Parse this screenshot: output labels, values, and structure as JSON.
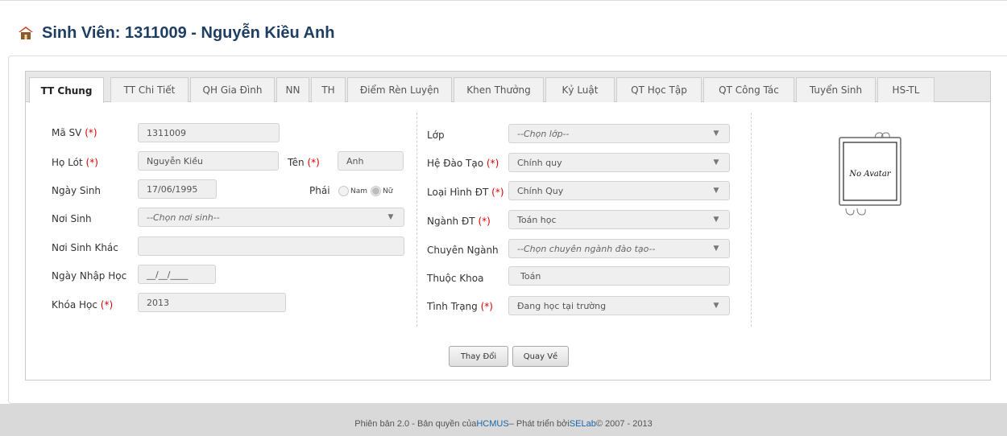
{
  "header": {
    "title": "Sinh Viên: 1311009 - Nguyễn Kiều Anh",
    "icon": "home-icon"
  },
  "tabs": [
    {
      "label": "TT Chung",
      "active": true
    },
    {
      "label": "TT Chi Tiết",
      "active": false
    },
    {
      "label": "QH Gia Đình",
      "active": false
    },
    {
      "label": "NN",
      "active": false
    },
    {
      "label": "TH",
      "active": false
    },
    {
      "label": "Điểm Rèn Luyện",
      "active": false
    },
    {
      "label": "Khen Thưởng",
      "active": false
    },
    {
      "label": "Kỷ Luật",
      "active": false
    },
    {
      "label": "QT Học Tập",
      "active": false
    },
    {
      "label": "QT Công Tác",
      "active": false
    },
    {
      "label": "Tuyển Sinh",
      "active": false
    },
    {
      "label": "HS-TL",
      "active": false
    }
  ],
  "required_mark": "(*)",
  "form_left": {
    "ma_sv": {
      "label": "Mã SV",
      "value": "1311009"
    },
    "ho_lot": {
      "label": "Họ Lót",
      "value": "Nguyễn Kiều"
    },
    "ten": {
      "label": "Tên",
      "value": "Anh"
    },
    "ngay_sinh": {
      "label": "Ngày Sinh",
      "value": "17/06/1995"
    },
    "phai": {
      "label": "Phái",
      "option_male": "Nam",
      "option_female": "Nữ",
      "selected": "Nữ"
    },
    "noi_sinh": {
      "label": "Nơi Sinh",
      "value": "--Chọn nơi sinh--"
    },
    "noi_sinh_khac": {
      "label": "Nơi Sinh Khác",
      "value": ""
    },
    "ngay_nhap_hoc": {
      "label": "Ngày Nhập Học",
      "value": "__/__/____"
    },
    "khoa_hoc": {
      "label": "Khóa Học",
      "value": "2013"
    }
  },
  "form_right": {
    "lop": {
      "label": "Lớp",
      "value": "--Chọn lớp--"
    },
    "he_dao_tao": {
      "label": "Hệ Đào Tạo",
      "value": "Chính quy"
    },
    "loai_hinh_dt": {
      "label": "Loại Hình ĐT",
      "value": "Chính Quy"
    },
    "nganh_dt": {
      "label": "Ngành ĐT",
      "value": "Toán học"
    },
    "chuyen_nganh": {
      "label": "Chuyên Ngành",
      "value": "--Chọn chuyên ngành đào tạo--"
    },
    "thuoc_khoa": {
      "label": "Thuộc Khoa",
      "value": "Toán"
    },
    "tinh_trang": {
      "label": "Tình Trạng",
      "value": "Đang học tại trường"
    }
  },
  "avatar": {
    "text": "No Avatar"
  },
  "buttons": {
    "save": "Thay Đổi",
    "back": "Quay Về"
  },
  "footer": {
    "prefix": "Phiên bản 2.0 - Bản quyền của ",
    "org": "HCMUS",
    "middle": " – Phát triển bởi ",
    "lab": "SELab",
    "suffix": " © 2007 - 2013"
  },
  "colors": {
    "title": "#1e3f63",
    "required": "#dd0000",
    "link": "#1a64a8",
    "home_icon_roof": "#d0421b"
  }
}
